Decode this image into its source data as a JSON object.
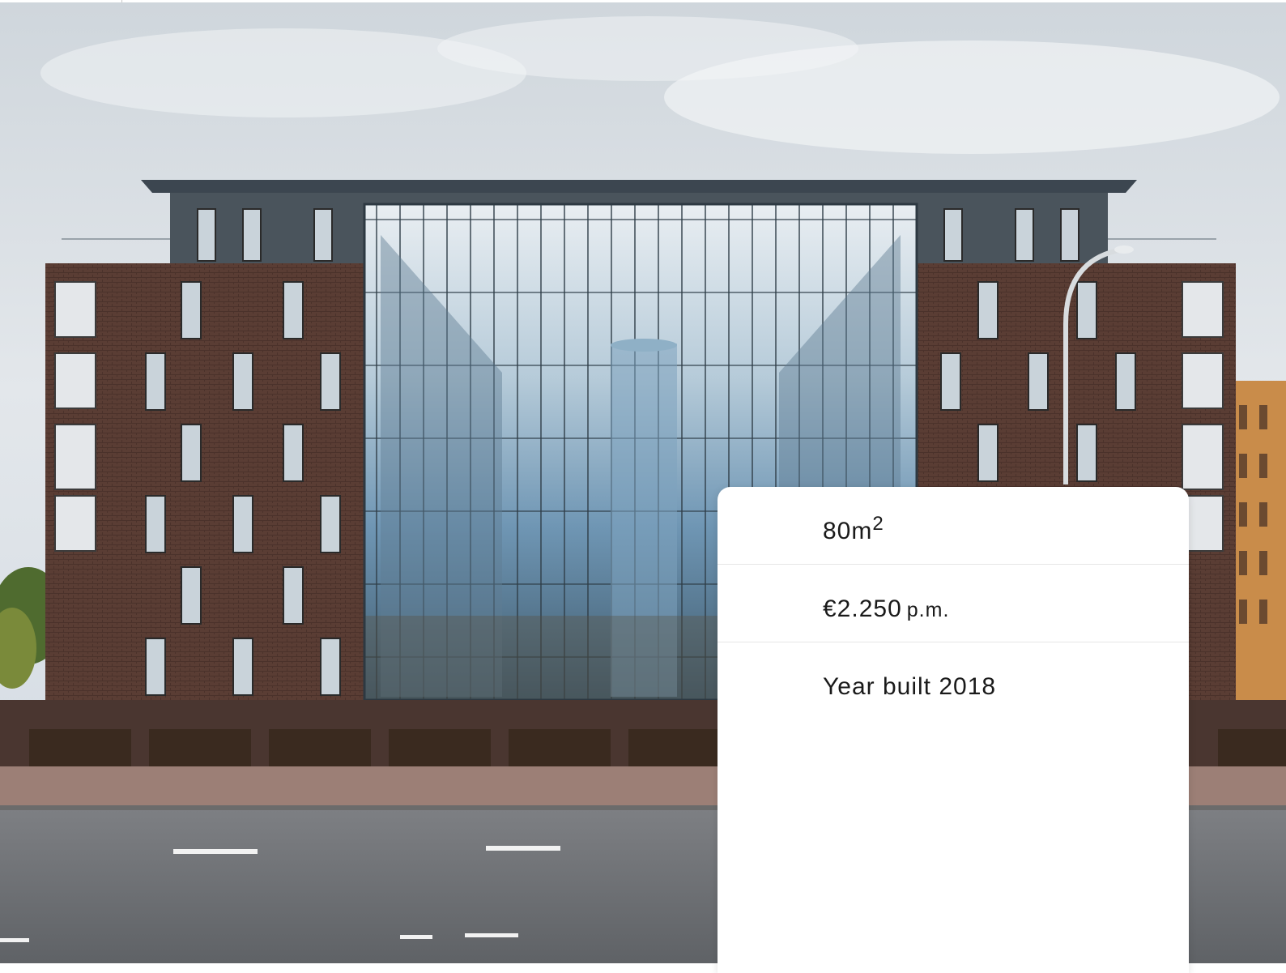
{
  "listing": {
    "area_value": "80m",
    "area_unit_exponent": "2",
    "price_value": "€2.250",
    "price_suffix": "p.m.",
    "year_built": "Year built 2018"
  },
  "colors": {
    "card_background": "#ffffff",
    "text": "#1a1a1a",
    "divider": "#e6e6e6",
    "brick": "#5b3f36",
    "sky": "#d9dee3"
  }
}
